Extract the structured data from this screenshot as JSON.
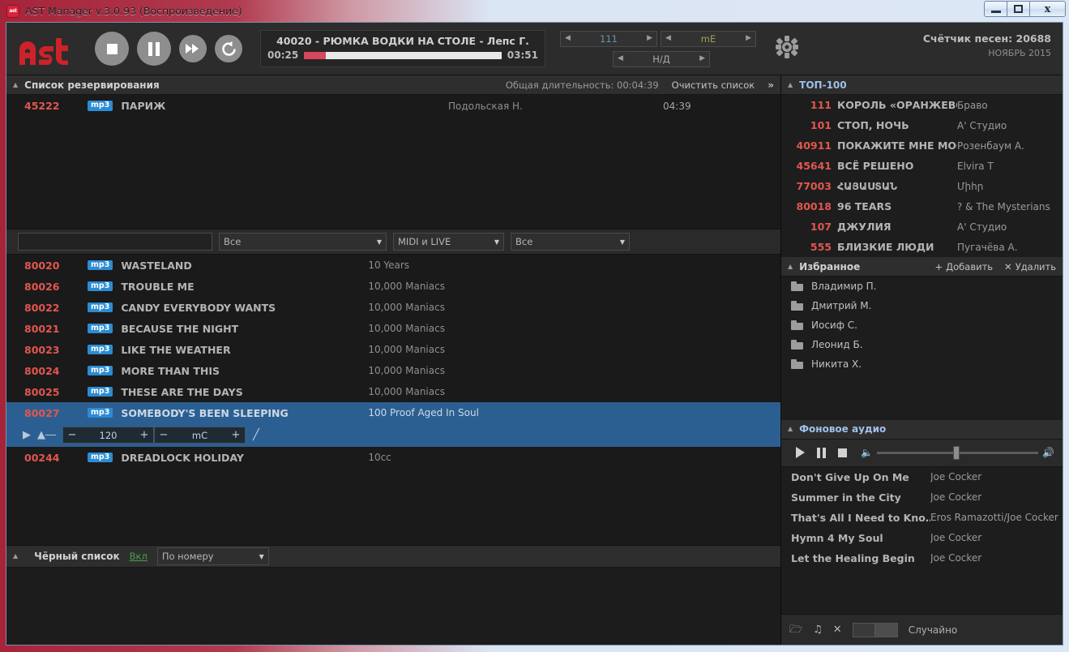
{
  "window": {
    "title": "AST Manager v.3.0.93 (Воспроизведение)",
    "icon": "ast",
    "minimize": "–",
    "maximize": "□",
    "close": "✕"
  },
  "player": {
    "logo": "ast",
    "buttons": [
      {
        "name": "stop-button",
        "icon": "stop"
      },
      {
        "name": "pause-button",
        "icon": "pause"
      },
      {
        "name": "next-button",
        "icon": "fast-forward"
      },
      {
        "name": "restart-button",
        "icon": "refresh"
      }
    ],
    "now_playing": {
      "title": "40020 - РЮМКА ВОДКИ НА СТОЛЕ - Лепс Г.",
      "elapsed": "00:25",
      "total": "03:51",
      "progress_percent": 11
    },
    "spinners": [
      {
        "name": "tempo-spinner",
        "value": "111",
        "style": "num"
      },
      {
        "name": "key-spinner",
        "value": "mE",
        "style": "key"
      },
      {
        "name": "extra-spinner",
        "value": "Н/Д",
        "style": "na"
      }
    ],
    "settings_icon": "gear-icon",
    "counter_label": "Счётчик песен: 20688",
    "counter_period": "НОЯБРЬ 2015"
  },
  "reservation": {
    "title": "Список резервирования",
    "total_label": "Общая длительность: 00:04:39",
    "clear_label": "Очистить список",
    "expand_icon": "»",
    "rows": [
      {
        "id": "45222",
        "format": "mp3",
        "title": "ПАРИЖ",
        "artist": "Подольская Н.",
        "duration": "04:39"
      }
    ]
  },
  "filters": {
    "search_value": "",
    "search_placeholder": "",
    "selects": [
      {
        "name": "genre-select",
        "value": "Все"
      },
      {
        "name": "type-select",
        "value": "MIDI и LIVE"
      },
      {
        "name": "lang-select",
        "value": "Все"
      }
    ]
  },
  "songs": {
    "rows": [
      {
        "id": "80020",
        "format": "mp3",
        "title": "WASTELAND",
        "artist": "10 Years",
        "selected": false
      },
      {
        "id": "80026",
        "format": "mp3",
        "title": "TROUBLE ME",
        "artist": "10,000 Maniacs",
        "selected": false
      },
      {
        "id": "80022",
        "format": "mp3",
        "title": "CANDY EVERYBODY WANTS",
        "artist": "10,000 Maniacs",
        "selected": false
      },
      {
        "id": "80021",
        "format": "mp3",
        "title": "BECAUSE THE NIGHT",
        "artist": "10,000 Maniacs",
        "selected": false
      },
      {
        "id": "80023",
        "format": "mp3",
        "title": "LIKE THE WEATHER",
        "artist": "10,000 Maniacs",
        "selected": false
      },
      {
        "id": "80024",
        "format": "mp3",
        "title": "MORE THAN THIS",
        "artist": "10,000 Maniacs",
        "selected": false
      },
      {
        "id": "80025",
        "format": "mp3",
        "title": "THESE ARE THE DAYS",
        "artist": "10,000 Maniacs",
        "selected": false
      },
      {
        "id": "80027",
        "format": "mp3",
        "title": "SOMEBODY'S BEEN SLEEPING",
        "artist": "100 Proof Aged In Soul",
        "selected": true
      },
      {
        "id": "00244",
        "format": "mp3",
        "title": "DREADLOCK HOLIDAY",
        "artist": "10cc",
        "selected": false
      }
    ],
    "selected_controls": {
      "play_icon": "play-icon",
      "reserve_icon": "add-to-top-icon",
      "tempo_minus": "−",
      "tempo_value": "120",
      "tempo_plus": "+",
      "key_minus": "−",
      "key_value": "mC",
      "key_plus": "+",
      "edit_icon": "pencil-icon"
    }
  },
  "blacklist": {
    "title": "Чёрный список",
    "state_label": "Вкл",
    "sort_value": "По номеру"
  },
  "top100": {
    "title": "ТОП-100",
    "rows": [
      {
        "num": "111",
        "title": "КОРОЛЬ «ОРАНЖЕВОЕ Л…",
        "artist": "Браво"
      },
      {
        "num": "101",
        "title": "СТОП, НОЧЬ",
        "artist": "A' Студио"
      },
      {
        "num": "40911",
        "title": "ПОКАЖИТЕ МНЕ МОСКВУ",
        "artist": "Розенбаум А."
      },
      {
        "num": "45641",
        "title": "ВСЁ РЕШЕНО",
        "artist": "Elvira T"
      },
      {
        "num": "77003",
        "title": "ՀԱՅԱՍՏԱՆ",
        "artist": "Միհր"
      },
      {
        "num": "80018",
        "title": "96 TEARS",
        "artist": "? & The Mysterians"
      },
      {
        "num": "107",
        "title": "ДЖУЛИЯ",
        "artist": "A' Студио"
      },
      {
        "num": "555",
        "title": "БЛИЗКИЕ ЛЮДИ",
        "artist": "Пугачёва А."
      }
    ]
  },
  "favorites": {
    "title": "Избранное",
    "add_label": "Добавить",
    "delete_label": "Удалить",
    "items": [
      {
        "name": "Владимир П."
      },
      {
        "name": "Дмитрий М."
      },
      {
        "name": "Иосиф С."
      },
      {
        "name": "Леонид Б."
      },
      {
        "name": "Никита Х."
      }
    ]
  },
  "background_audio": {
    "title": "Фоновое аудио",
    "volume_percent": 47,
    "tracks": [
      {
        "title": "Don't Give Up On Me",
        "artist": "Joe Cocker"
      },
      {
        "title": "Summer in the City",
        "artist": "Joe Cocker"
      },
      {
        "title": "That's All I Need to Kno…",
        "artist": "Eros Ramazotti/Joe Cocker"
      },
      {
        "title": "Hymn 4 My Soul",
        "artist": "Joe Cocker"
      },
      {
        "title": "Let the Healing Begin",
        "artist": "Joe Cocker"
      }
    ],
    "footer": {
      "add_folder_icon": "folder-add-icon",
      "add_track_icon": "note-add-icon",
      "remove_icon": "close-icon",
      "shuffle_label": "Случайно",
      "shuffle_on": false
    }
  },
  "colors": {
    "accent_red": "#e2564f",
    "badge_blue": "#2b8cd4",
    "selection_blue": "#2c5f91",
    "brand_red": "#cc2229",
    "link_green": "#4c9e4c"
  }
}
